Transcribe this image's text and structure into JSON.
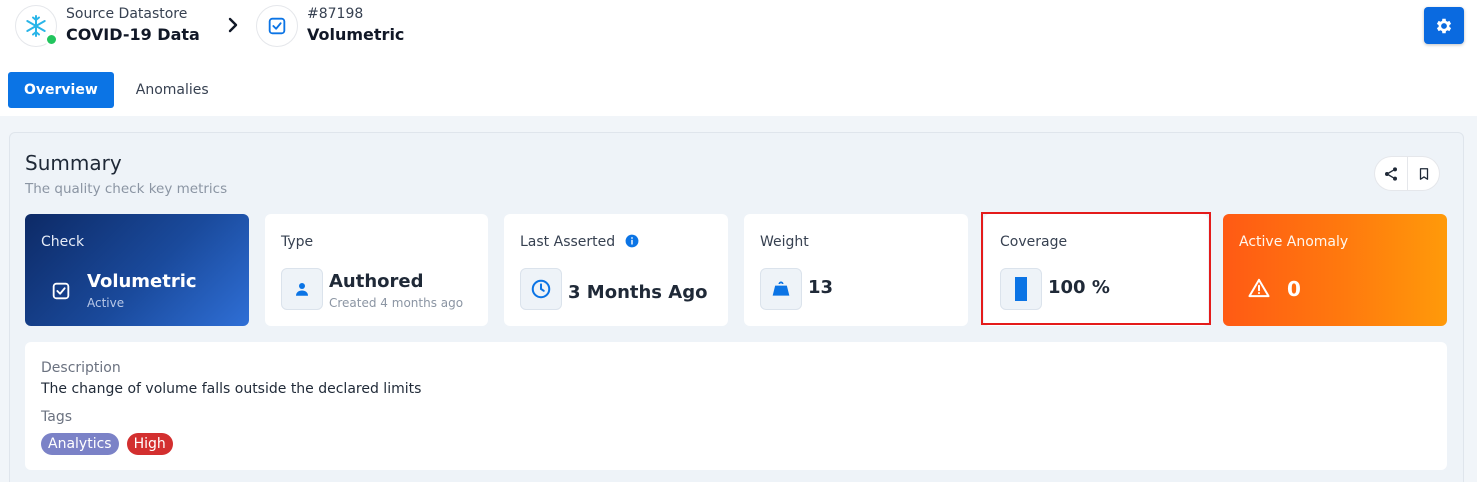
{
  "header": {
    "datastore": {
      "sub_label": "Source Datastore",
      "name": "COVID-19 Data"
    },
    "check": {
      "id": "#87198",
      "name": "Volumetric"
    }
  },
  "tabs": [
    {
      "label": "Overview",
      "active": true
    },
    {
      "label": "Anomalies",
      "active": false
    }
  ],
  "summary": {
    "title": "Summary",
    "subtitle": "The quality check key metrics"
  },
  "cards": {
    "check": {
      "label": "Check",
      "value": "Volumetric",
      "status": "Active"
    },
    "type": {
      "label": "Type",
      "value": "Authored",
      "note": "Created 4 months ago"
    },
    "last_asserted": {
      "label": "Last Asserted",
      "value": "3 Months Ago"
    },
    "weight": {
      "label": "Weight",
      "value": "13"
    },
    "coverage": {
      "label": "Coverage",
      "value": "100 %",
      "fraction": 1.0
    },
    "active_anomaly": {
      "label": "Active Anomaly",
      "value": "0"
    }
  },
  "description": {
    "label": "Description",
    "text": "The change of volume falls outside the declared limits"
  },
  "tags": {
    "label": "Tags",
    "items": [
      {
        "label": "Analytics",
        "color": "#7b82c7"
      },
      {
        "label": "High",
        "color": "#d32f2f"
      }
    ]
  },
  "colors": {
    "primary": "#0b74e5",
    "highlight": "#e41b1b",
    "status_ok": "#22c55e",
    "anomaly_gradient_start": "#ff5a14",
    "check_gradient_start": "#0d2a66"
  }
}
